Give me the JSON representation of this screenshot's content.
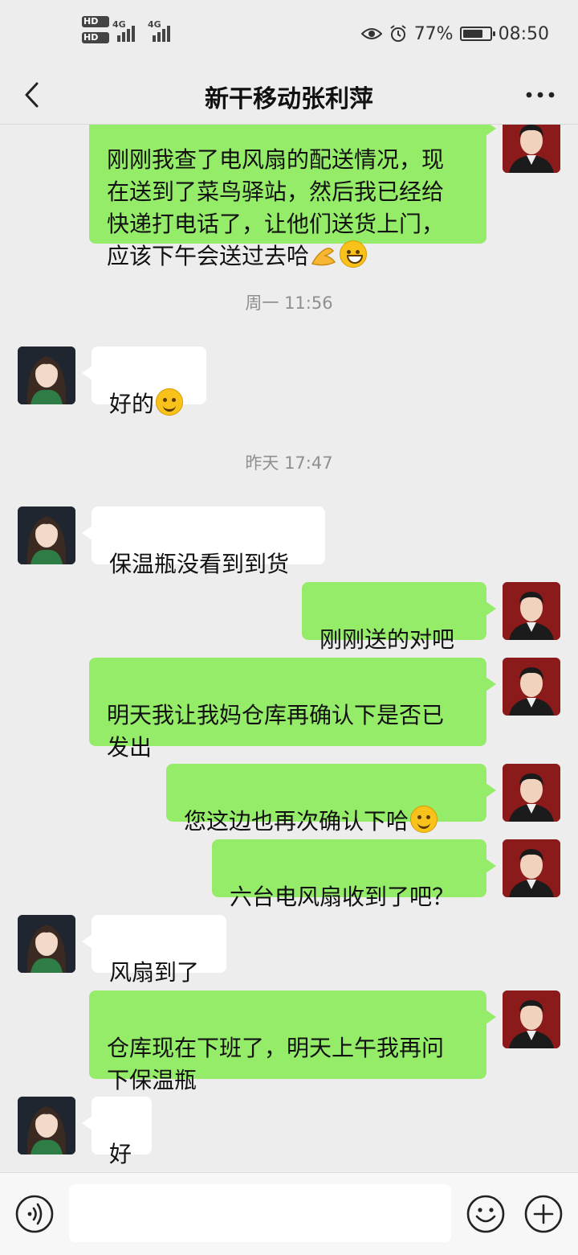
{
  "status": {
    "hd1": "HD",
    "hd2": "HD",
    "net1": "4G",
    "net2": "4G",
    "battery": "77%",
    "battery_level": 0.77,
    "time": "08:50"
  },
  "header": {
    "title": "新干移动张利萍",
    "back_icon": "chevron-left-icon",
    "more_icon": "more-dots-icon"
  },
  "messages": {
    "m0": {
      "sender": "me",
      "text": "刚刚我查了电风扇的配送情况，现\n在送到了菜鸟驿站，然后我已经给\n快递打电话了，让他们送货上门，\n应该下午会送过去哈"
    },
    "ts1": "周一 11:56",
    "m1": {
      "sender": "them",
      "text": "好的"
    },
    "ts2": "昨天 17:47",
    "m2": {
      "sender": "them",
      "text": "保温瓶没看到到货"
    },
    "m3": {
      "sender": "me",
      "text": "刚刚送的对吧"
    },
    "m4": {
      "sender": "me",
      "text": "明天我让我妈仓库再确认下是否已\n发出"
    },
    "m5": {
      "sender": "me",
      "text": "您这边也再次确认下哈"
    },
    "m6": {
      "sender": "me",
      "text": "六台电风扇收到了吧？"
    },
    "m7": {
      "sender": "them",
      "text": "风扇到了"
    },
    "m8": {
      "sender": "me",
      "text": "仓库现在下班了，明天上午我再问\n下保温瓶"
    },
    "m9": {
      "sender": "them",
      "text": "好"
    }
  },
  "input": {
    "value": "",
    "voice_icon": "voice-icon",
    "emoji_icon": "emoji-icon",
    "plus_icon": "plus-icon"
  },
  "colors": {
    "my_bubble": "#95ec69",
    "their_bubble": "#ffffff",
    "background": "#ededed"
  }
}
